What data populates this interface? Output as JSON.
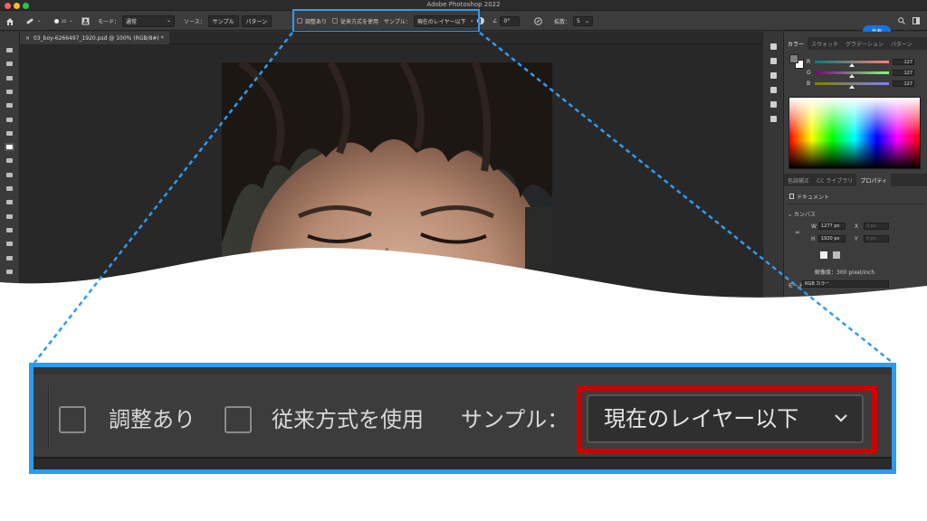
{
  "app": {
    "title": "Adobe Photoshop 2022"
  },
  "options_bar": {
    "mode_label": "モード：",
    "mode_value": "通常",
    "source_label": "ソース：",
    "source_buttons": [
      "サンプル",
      "パターン"
    ],
    "adjust_label": "調整あり",
    "legacy_label": "従来方式を使用",
    "sample_label": "サンプル：",
    "sample_value": "現在のレイヤー以下",
    "angle_value": "0°",
    "diffusion_label": "拡散：",
    "diffusion_value": "5",
    "brush_size": "20",
    "share_label": "共有"
  },
  "document": {
    "tab_label": "03_boy-6266497_1920.psd @ 100% (RGB/8#) *"
  },
  "color_panel": {
    "tabs": [
      "カラー",
      "スウォッチ",
      "グラデーション",
      "パターン"
    ],
    "channels": [
      {
        "label": "R",
        "value": "127"
      },
      {
        "label": "G",
        "value": "127"
      },
      {
        "label": "B",
        "value": "127"
      }
    ]
  },
  "properties_panel": {
    "tabs": [
      "色調補正",
      "CC ライブラリ",
      "プロパティ"
    ],
    "document_label": "ドキュメント",
    "canvas_section": "カンバス",
    "width_label": "W",
    "width_value": "1277 px",
    "height_label": "H",
    "height_value": "1920 px",
    "x_label": "X",
    "x_value": "0 px",
    "y_label": "Y",
    "y_value": "0 px",
    "resolution": "解像度：300 pixel/inch",
    "mode_label": "モード",
    "mode_value": "RGB カラー"
  },
  "zoom_callout": {
    "adjust_label": "調整あり",
    "legacy_label": "従来方式を使用",
    "sample_label": "サンプル：",
    "sample_value": "現在のレイヤー以下"
  },
  "colors": {
    "highlight_blue": "#2d9cf0",
    "highlight_red": "#cc0000",
    "share_blue": "#1473e6"
  }
}
